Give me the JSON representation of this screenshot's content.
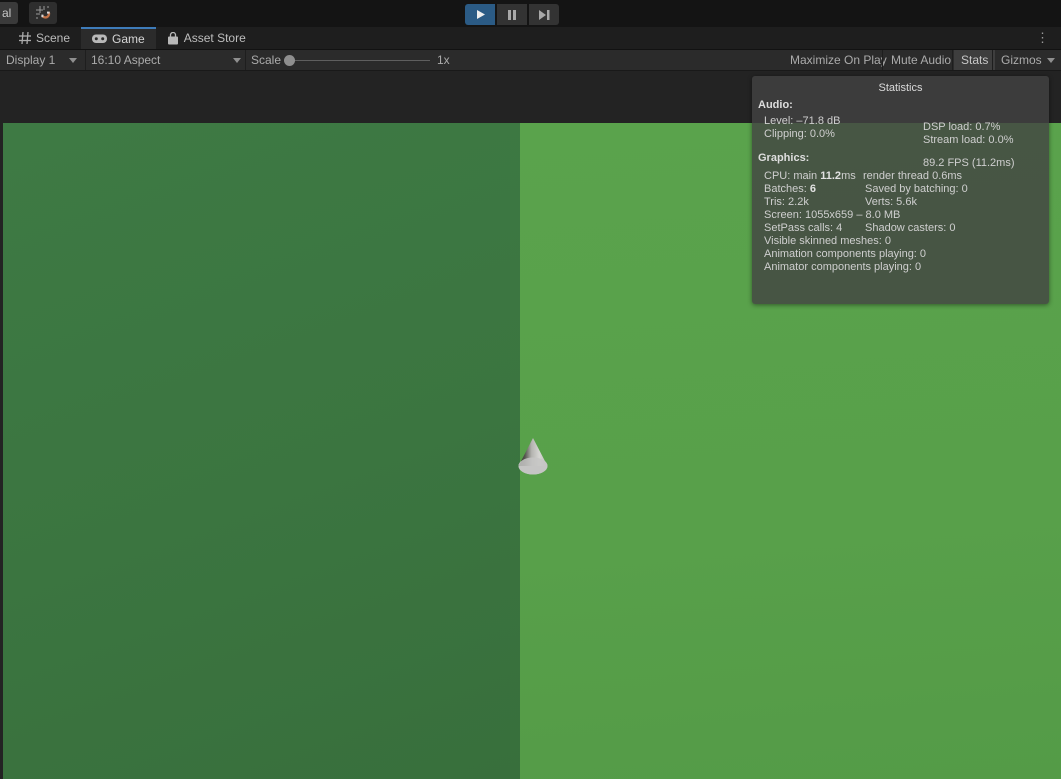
{
  "topbar": {
    "clipped_button_label": "al"
  },
  "tabs": {
    "scene": "Scene",
    "game": "Game",
    "asset_store": "Asset Store",
    "kebab": "⋮"
  },
  "toolbar": {
    "display_dropdown": "Display 1",
    "aspect_dropdown": "16:10 Aspect",
    "scale_label": "Scale",
    "scale_value": "1x",
    "maximize_on_play": "Maximize On Play",
    "mute_audio": "Mute Audio",
    "stats": "Stats",
    "gizmos": "Gizmos"
  },
  "stats_panel": {
    "title": "Statistics",
    "audio": {
      "heading": "Audio:",
      "level": "Level: –71.8 dB",
      "clipping": "Clipping: 0.0%",
      "dsp_load": "DSP load: 0.7%",
      "stream_load": "Stream load: 0.0%"
    },
    "graphics": {
      "heading": "Graphics:",
      "fps": "89.2 FPS (11.2ms)",
      "cpu_prefix": "CPU: main",
      "cpu_main_time": "11.2",
      "cpu_main_unit": "ms",
      "render_thread": "render thread 0.6ms",
      "batches_label": "Batches:",
      "batches_value": "6",
      "saved_by_batching": "Saved by batching: 0",
      "tris": "Tris: 2.2k",
      "verts": "Verts: 5.6k",
      "screen": "Screen: 1055x659 – 8.0 MB",
      "setpass_calls": "SetPass calls: 4",
      "shadow_casters": "Shadow casters: 0",
      "visible_skinned_meshes": "Visible skinned meshes: 0",
      "animation_components": "Animation components playing: 0",
      "animator_components": "Animator components playing: 0"
    }
  },
  "colors": {
    "accent_blue": "#3e7cba",
    "play_button_active": "#2b5b85",
    "ground_left_green": "#3b7540",
    "ground_right_green": "#58a04a"
  }
}
